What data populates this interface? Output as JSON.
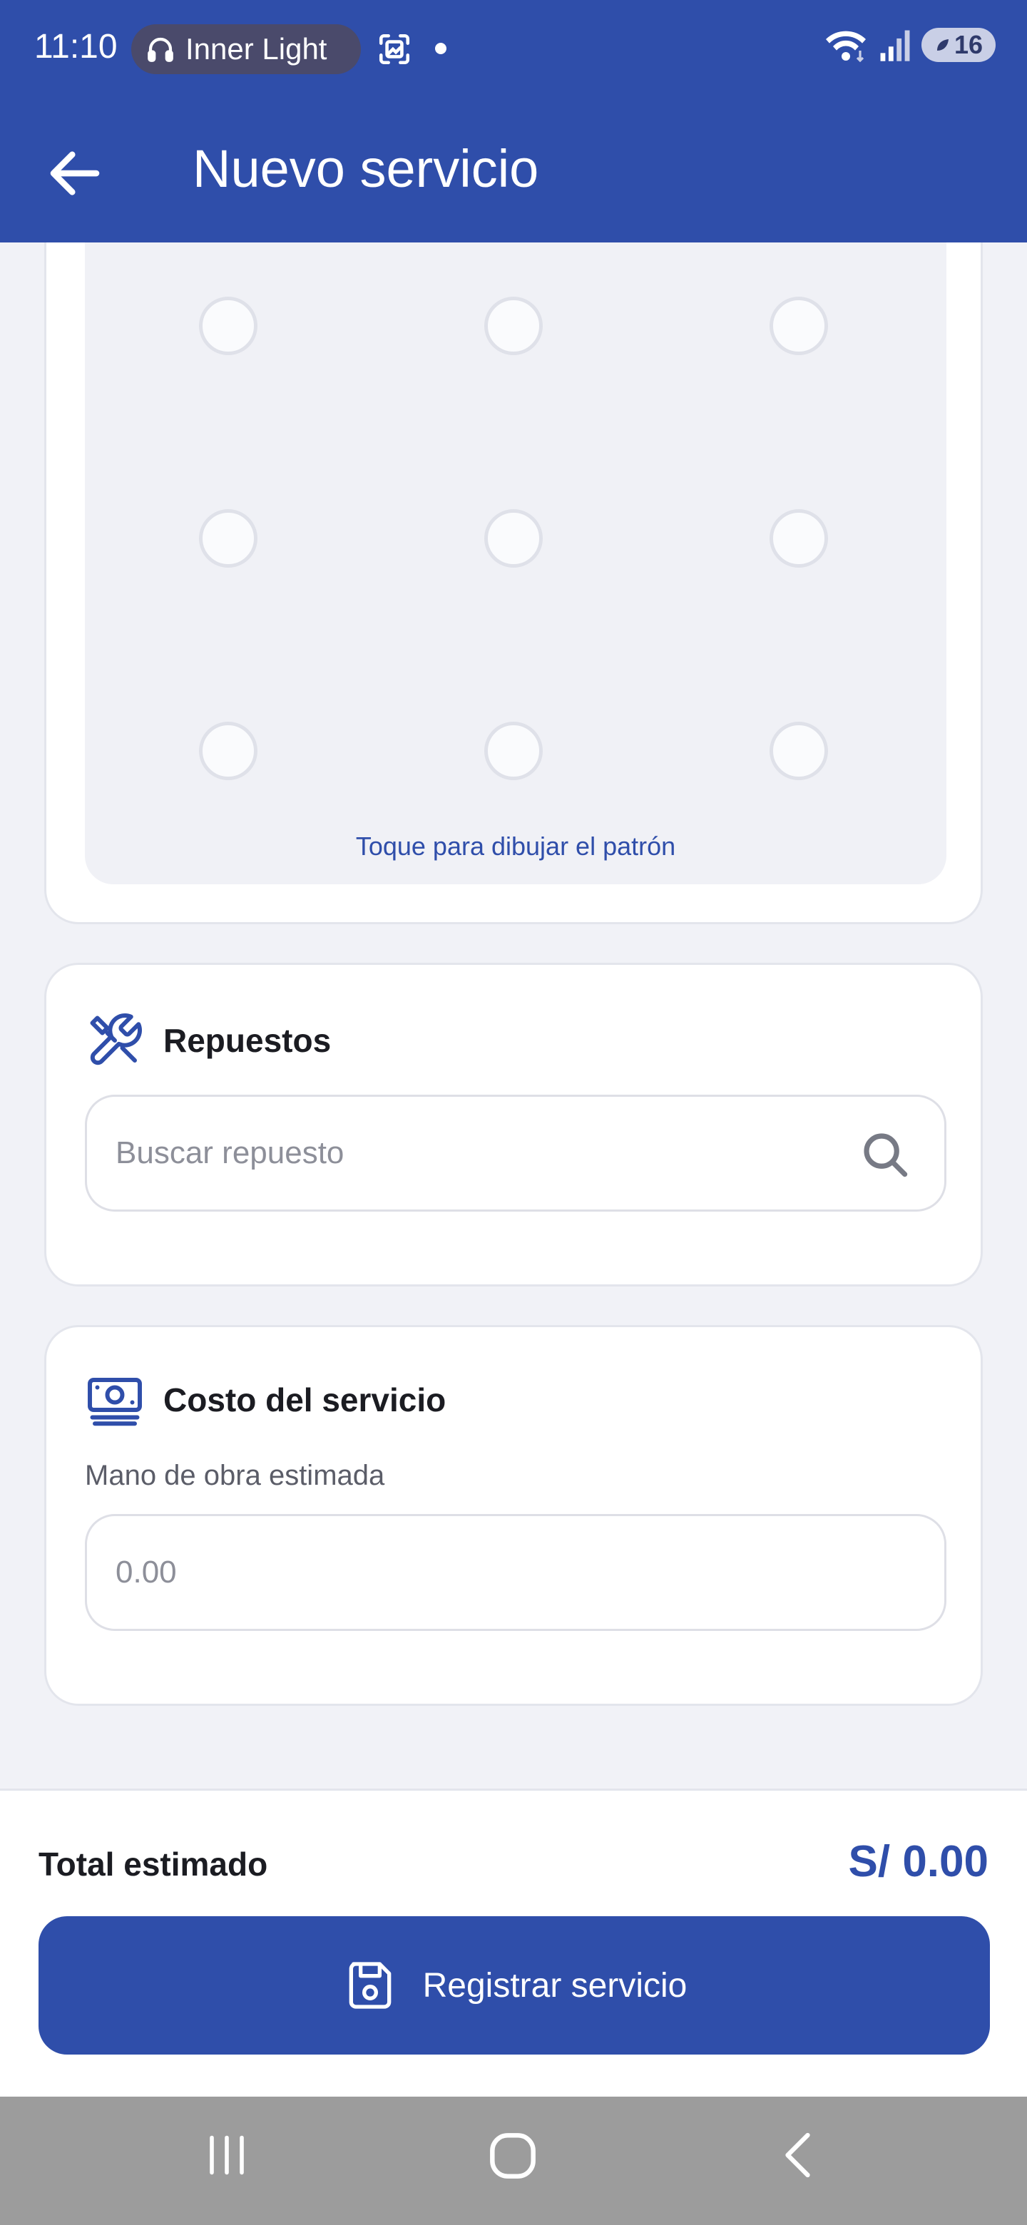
{
  "status_bar": {
    "time": "11:10",
    "media_label": "Inner Light",
    "battery": "16"
  },
  "app_bar": {
    "title": "Nuevo servicio",
    "back_icon": "arrow-left-icon"
  },
  "pattern": {
    "hint": "Toque para dibujar el patrón",
    "dots": 9
  },
  "repuestos": {
    "title": "Repuestos",
    "icon": "tools-icon",
    "search_placeholder": "Buscar repuesto",
    "search_value": ""
  },
  "costo": {
    "title": "Costo del servicio",
    "icon": "cash-icon",
    "labor_label": "Mano de obra estimada",
    "labor_placeholder": "0.00",
    "labor_value": ""
  },
  "summary": {
    "total_label": "Total estimado",
    "total_value": "S/ 0.00",
    "submit_label": "Registrar servicio",
    "submit_icon": "save-icon"
  },
  "colors": {
    "primary": "#2f4eaa",
    "background": "#f1f2f7",
    "card": "#ffffff"
  }
}
